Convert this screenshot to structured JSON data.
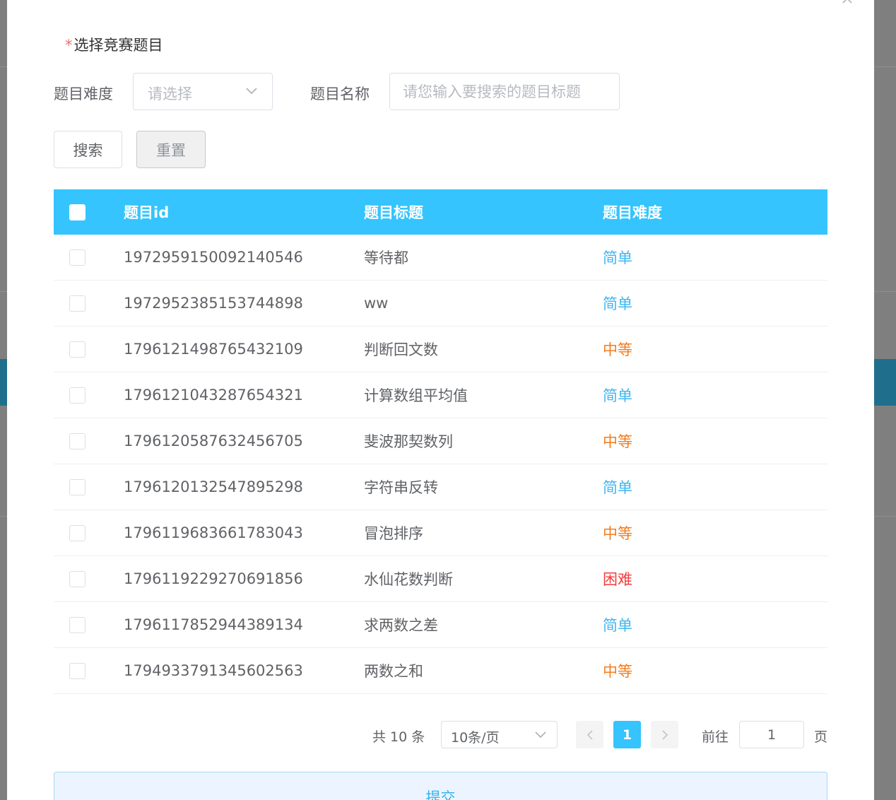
{
  "form": {
    "section_title": "选择竞赛题目",
    "required_mark": "*",
    "difficulty_label": "题目难度",
    "difficulty_placeholder": "请选择",
    "name_label": "题目名称",
    "name_placeholder": "请您输入要搜索的题目标题",
    "search_button": "搜索",
    "reset_button": "重置"
  },
  "table": {
    "headers": {
      "id": "题目id",
      "title": "题目标题",
      "difficulty": "题目难度"
    },
    "rows": [
      {
        "id": "1972959150092140546",
        "title": "等待都",
        "difficulty": "简单",
        "level": "easy"
      },
      {
        "id": "1972952385153744898",
        "title": "ww",
        "difficulty": "简单",
        "level": "easy"
      },
      {
        "id": "1796121498765432109",
        "title": "判断回文数",
        "difficulty": "中等",
        "level": "mid"
      },
      {
        "id": "1796121043287654321",
        "title": "计算数组平均值",
        "difficulty": "简单",
        "level": "easy"
      },
      {
        "id": "1796120587632456705",
        "title": "斐波那契数列",
        "difficulty": "中等",
        "level": "mid"
      },
      {
        "id": "1796120132547895298",
        "title": "字符串反转",
        "difficulty": "简单",
        "level": "easy"
      },
      {
        "id": "1796119683661783043",
        "title": "冒泡排序",
        "difficulty": "中等",
        "level": "mid"
      },
      {
        "id": "1796119229270691856",
        "title": "水仙花数判断",
        "difficulty": "困难",
        "level": "hard"
      },
      {
        "id": "1796117852944389134",
        "title": "求两数之差",
        "difficulty": "简单",
        "level": "easy"
      },
      {
        "id": "1794933791345602563",
        "title": "两数之和",
        "difficulty": "中等",
        "level": "mid"
      }
    ]
  },
  "pagination": {
    "total_text": "共 10 条",
    "page_size": "10条/页",
    "current_page": "1",
    "goto_label": "前往",
    "goto_value": "1",
    "page_unit": "页"
  },
  "submit_button": "提交",
  "colors": {
    "header_bg": "#35c4fd",
    "easy": "#3fb6f0",
    "mid": "#f47c1b",
    "hard": "#f53c3c"
  }
}
